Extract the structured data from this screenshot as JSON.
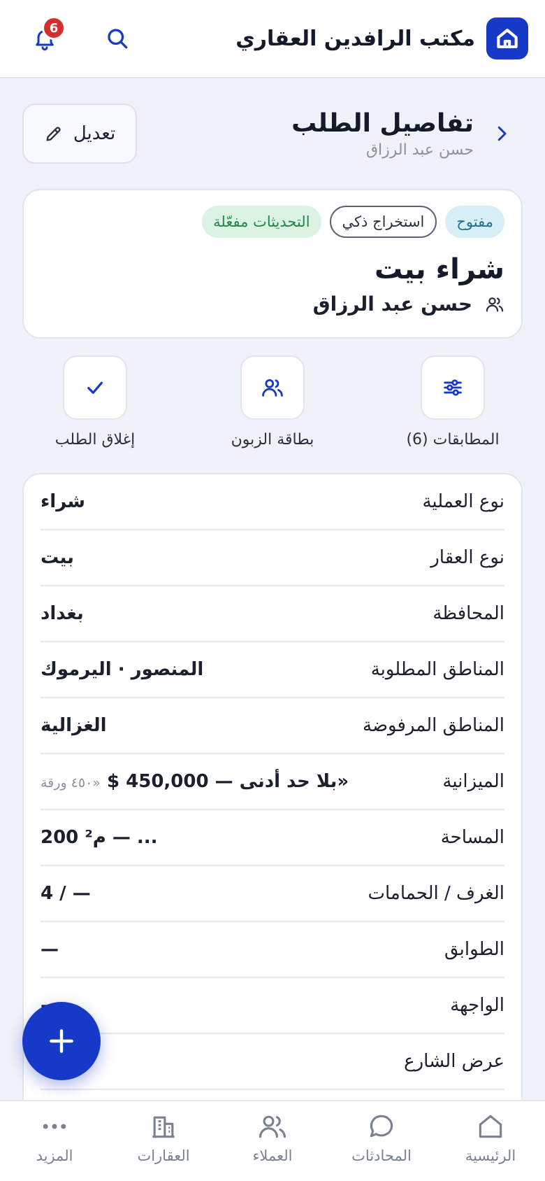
{
  "header": {
    "app_title": "مكتب الرافدين العقاري",
    "notifications_count": "6"
  },
  "page": {
    "title": "تفاصيل الطلب",
    "subtitle": "حسن عبد الرزاق",
    "edit_label": "تعديل"
  },
  "summary": {
    "chip_open": "مفتوح",
    "chip_ai": "استخراج ذكي",
    "chip_updates": "التحديثات مفعّلة",
    "title": "شراء بيت",
    "client_name": "حسن عبد الرزاق"
  },
  "actions": {
    "matches": "المطابقات (6)",
    "client_card": "بطاقة الزبون",
    "close_request": "إغلاق الطلب"
  },
  "details": [
    {
      "label": "نوع العملية",
      "value": "شراء"
    },
    {
      "label": "نوع العقار",
      "value": "بيت"
    },
    {
      "label": "المحافظة",
      "value": "بغداد"
    },
    {
      "label": "المناطق المطلوبة",
      "value": "المنصور · اليرموك"
    },
    {
      "label": "المناطق المرفوضة",
      "value": "الغزالية"
    },
    {
      "label": "الميزانية",
      "value": "«بلا حد أدنى — 450,000 $",
      "note": "«٤٥٠ ورقة"
    },
    {
      "label": "المساحة",
      "value": "... — م² 200"
    },
    {
      "label": "الغرف / الحمامات",
      "value": "— / 4"
    },
    {
      "label": "الطوابق",
      "value": "—"
    },
    {
      "label": "الواجهة",
      "value": "—"
    },
    {
      "label": "عرض الشارع",
      "value": "—"
    }
  ],
  "nav": {
    "home": "الرئيسية",
    "chats": "المحادثات",
    "clients": "العملاء",
    "properties": "العقارات",
    "more": "المزيد"
  },
  "colors": {
    "primary": "#1739c7",
    "badge": "#d32f2f",
    "chip_open_bg": "#d8eef7",
    "chip_updates_bg": "#dcf3e4"
  }
}
